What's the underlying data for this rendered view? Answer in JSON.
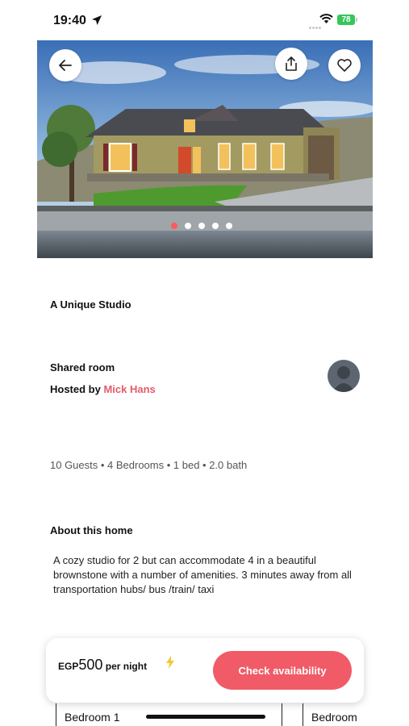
{
  "status_bar": {
    "time": "19:40",
    "battery": "78"
  },
  "listing": {
    "title": "A Unique Studio",
    "room_type": "Shared room",
    "hosted_by_label": "Hosted by",
    "host_name": "Mick Hans",
    "stats": "10 Guests • 4 Bedrooms • 1 bed • 2.0 bath",
    "about_title": "About this home",
    "about_text": "A cozy studio  for 2 but can accommodate 4 in a beautiful brownstone with a number of amenities. 3 minutes away from all transportation hubs/ bus /train/ taxi",
    "photo_count": 5,
    "active_photo": 1
  },
  "booking": {
    "currency": "EGP",
    "amount": "500",
    "per_night": "per night",
    "check_label": "Check availability"
  },
  "bedrooms": [
    "Bedroom 1",
    "Bedroom"
  ],
  "colors": {
    "accent": "#f05b67",
    "host_link": "#e35b6b",
    "battery": "#34c759"
  },
  "icons": [
    "back-arrow-icon",
    "share-icon",
    "heart-icon",
    "bolt-icon",
    "location-arrow-icon",
    "wifi-icon"
  ]
}
